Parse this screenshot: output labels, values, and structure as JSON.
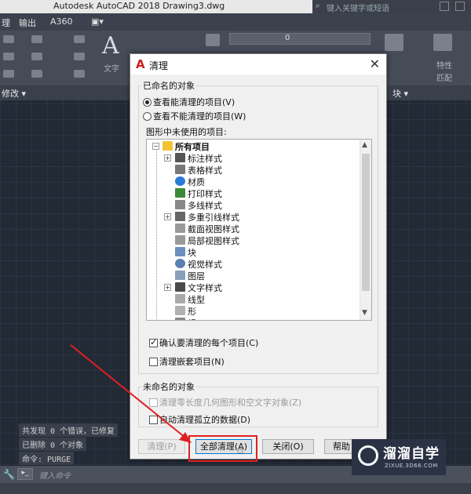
{
  "window": {
    "title": "Autodesk AutoCAD 2018     Drawing3.dwg",
    "search_placeholder": "键入关键字或短语"
  },
  "menubar": {
    "items": [
      "理",
      "输出",
      "A360",
      "▣▾"
    ]
  },
  "ribbon": {
    "panel_label_left": "修改 ▾",
    "panel_label_right": "块 ▾",
    "text_label": "文字",
    "layer_value": "0",
    "right_labels": [
      "特性",
      "匹配"
    ]
  },
  "command": {
    "history": [
      "共发现 0 个错误，已修复",
      "已删除 0 个对象",
      "命令: PURGE"
    ],
    "input_placeholder": "键入命令"
  },
  "dialog": {
    "title": "清理",
    "named_group": "已命名的对象",
    "radio_purgeable": "查看能清理的项目(V)",
    "radio_nonpurgeable": "查看不能清理的项目(W)",
    "unused_label": "图形中未使用的项目:",
    "tree_root": "所有项目",
    "tree_items": [
      "标注样式",
      "表格样式",
      "材质",
      "打印样式",
      "多线样式",
      "多重引线样式",
      "截面视图样式",
      "局部视图样式",
      "块",
      "视觉样式",
      "图层",
      "文字样式",
      "线型",
      "形",
      "组"
    ],
    "confirm_each": "确认要清理的每个项目(C)",
    "purge_nested": "清理嵌套项目(N)",
    "unnamed_group": "未命名的对象",
    "purge_zero": "清理零长度几何图形和空文字对象(Z)",
    "auto_orphan": "自动清理孤立的数据(D)",
    "btn_purge": "清理(P)",
    "btn_purge_all": "全部清理(A)",
    "btn_close": "关闭(O)",
    "btn_help": "帮助"
  },
  "watermark": {
    "title": "溜溜自学",
    "sub": "ZIXUE.3D66.COM"
  },
  "colors": {
    "highlight": "#e02020",
    "accent": "#0078d7",
    "logo": "#d0201b"
  }
}
